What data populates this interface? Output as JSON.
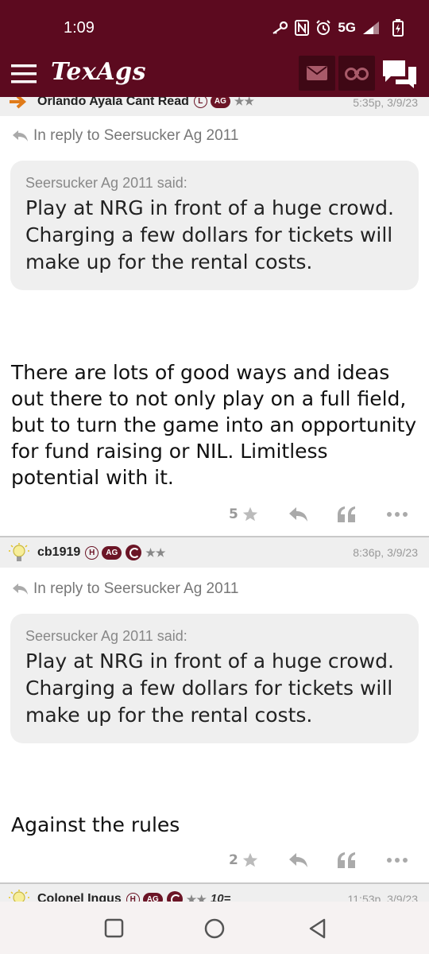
{
  "status_bar": {
    "time": "1:09",
    "network": "5G"
  },
  "app_bar": {
    "brand": "TexAgs",
    "brand_color": "#5c0a1f"
  },
  "posts": [
    {
      "user": "Orlando Ayala Cant Read",
      "badges": [
        "L",
        "AG"
      ],
      "stars": "★★",
      "time": "5:35p, 3/9/23",
      "icon": "arrow-icon"
    },
    {
      "reply_to": "In reply to Seersucker Ag 2011",
      "quote_author": "Seersucker Ag 2011 said:",
      "quote_text": "Play at NRG in front of a huge crowd. Charging a few dollars for tickets will make up for the rental costs.",
      "body": "There are lots of good ways and ideas out there to not only play on a full field, but to turn the game into an opportunity for fund raising or NIL. Limitless potential with it.",
      "star_count": "5"
    },
    {
      "user": "cb1919",
      "badges": [
        "H",
        "AG"
      ],
      "stars": "★★",
      "time": "8:36p, 3/9/23",
      "icon": "lightbulb-icon",
      "reply_to": "In reply to Seersucker Ag 2011",
      "quote_author": "Seersucker Ag 2011 said:",
      "quote_text": "Play at NRG in front of a huge crowd. Charging a few dollars for tickets will make up for the rental costs.",
      "body": "Against the rules",
      "star_count": "2"
    },
    {
      "user": "Colonel Ingus",
      "badges": [
        "H",
        "AG"
      ],
      "stars": "★★",
      "extra_badge": "10=",
      "time": "11:53p, 3/9/23",
      "icon": "lightbulb-icon"
    }
  ]
}
